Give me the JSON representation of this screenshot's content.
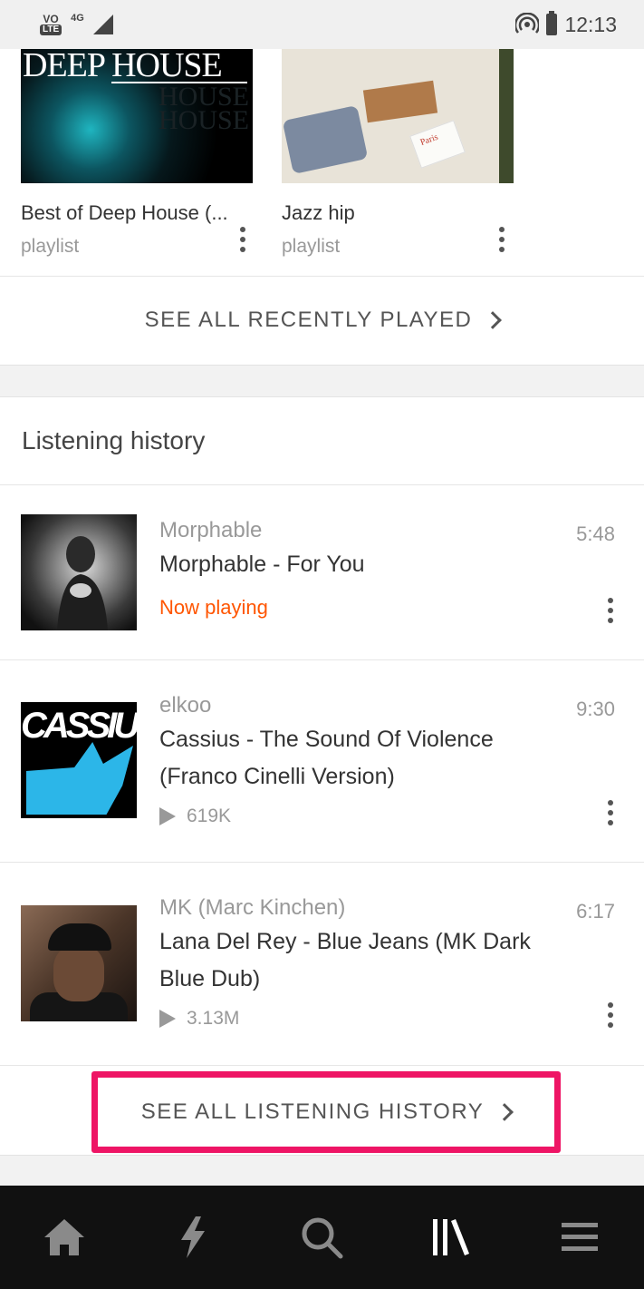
{
  "status_bar": {
    "volte": "VO",
    "lte": "LTE",
    "network": "4G",
    "time": "12:13"
  },
  "recently_played": {
    "cards": [
      {
        "title": "Best of Deep House (...",
        "type": "playlist",
        "cover_text": "DEEP HOUSE"
      },
      {
        "title": "Jazz hip",
        "type": "playlist",
        "cover_text": "Paris"
      }
    ],
    "see_all_label": "SEE ALL RECENTLY PLAYED"
  },
  "listening_history": {
    "heading": "Listening history",
    "tracks": [
      {
        "artist": "Morphable",
        "title": "Morphable - For You",
        "duration": "5:48",
        "status": "Now playing",
        "plays": ""
      },
      {
        "artist": "elkoo",
        "title": "Cassius - The Sound Of Violence (Franco Cinelli Version)",
        "duration": "9:30",
        "status": "",
        "plays": "619K",
        "cover_text": "CASSIUS"
      },
      {
        "artist": "MK (Marc Kinchen)",
        "title": "Lana Del Rey - Blue Jeans (MK Dark Blue Dub)",
        "duration": "6:17",
        "status": "",
        "plays": "3.13M"
      }
    ],
    "see_all_label": "SEE ALL LISTENING HISTORY"
  },
  "bottom_nav": {
    "items": [
      {
        "name": "home",
        "icon": "home-icon"
      },
      {
        "name": "stream",
        "icon": "lightning-icon"
      },
      {
        "name": "search",
        "icon": "search-icon"
      },
      {
        "name": "library",
        "icon": "library-icon",
        "active": true
      },
      {
        "name": "menu",
        "icon": "menu-icon"
      }
    ]
  },
  "colors": {
    "accent": "#ff5500",
    "highlight_border": "#ee1565",
    "nav_background": "#111111"
  }
}
